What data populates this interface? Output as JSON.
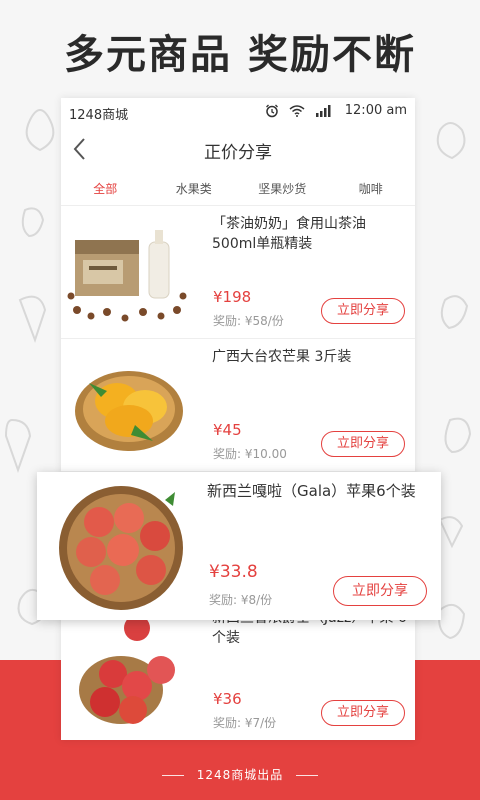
{
  "headline": "多元商品  奖励不断",
  "footer": {
    "text": "1248商城出品"
  },
  "statusbar": {
    "app_name": "1248商城",
    "time": "12:00 am"
  },
  "navbar": {
    "title": "正价分享"
  },
  "tabs": [
    {
      "label": "全部",
      "active": true
    },
    {
      "label": "水果类",
      "active": false
    },
    {
      "label": "坚果炒货",
      "active": false
    },
    {
      "label": "咖啡",
      "active": false
    }
  ],
  "products": [
    {
      "name": "「茶油奶奶」食用山茶油500ml单瓶精装",
      "price": "¥198",
      "reward": "奖励: ¥58/份",
      "share_label": "立即分享"
    },
    {
      "name": "广西大台农芒果 3斤装",
      "price": "¥45",
      "reward": "奖励: ¥10.00",
      "share_label": "立即分享"
    },
    {
      "name": "新西兰嘎啦（Gala）苹果6个装",
      "price": "¥33.8",
      "reward": "奖励: ¥8/份",
      "share_label": "立即分享"
    },
    {
      "name": "新西兰香浓爵士（Jazz）苹果 6个装",
      "price": "¥36",
      "reward": "奖励: ¥7/份",
      "share_label": "立即分享"
    }
  ],
  "colors": {
    "accent": "#e4413f",
    "text": "#333333",
    "muted": "#999999"
  },
  "icons": {
    "back": "chevron-left-icon",
    "alarm": "alarm-icon",
    "wifi": "wifi-icon",
    "signal": "signal-icon"
  }
}
